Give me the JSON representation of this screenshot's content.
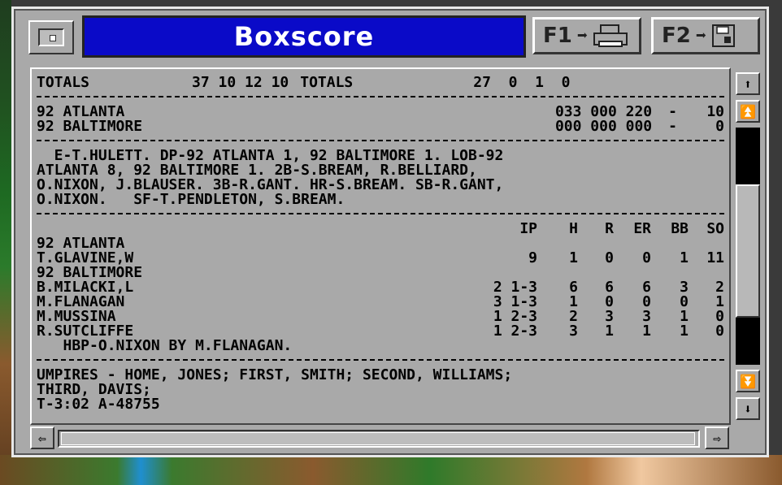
{
  "window": {
    "title": "Boxscore",
    "f1_label": "F1",
    "f2_label": "F2"
  },
  "totals": {
    "left": "TOTALS",
    "left_values": "37 10 12 10",
    "right": "TOTALS",
    "right_values": "27  0  1  0"
  },
  "linescore": [
    {
      "team": "92 ATLANTA",
      "innings": "033 000 220",
      "dash": "-",
      "runs": "10"
    },
    {
      "team": "92 BALTIMORE",
      "innings": "000 000 000",
      "dash": "-",
      "runs": "0"
    }
  ],
  "notes": [
    "  E-T.HULETT. DP-92 ATLANTA 1, 92 BALTIMORE 1. LOB-92",
    "ATLANTA 8, 92 BALTIMORE 1. 2B-S.BREAM, R.BELLIARD,",
    "O.NIXON, J.BLAUSER. 3B-R.GANT. HR-S.BREAM. SB-R.GANT,",
    "O.NIXON.   SF-T.PENDLETON, S.BREAM."
  ],
  "pitching": {
    "headers": [
      "IP",
      "H",
      "R",
      "ER",
      "BB",
      "SO"
    ],
    "teams": [
      {
        "name": "92 ATLANTA",
        "pitchers": [
          {
            "name": "T.GLAVINE,W",
            "ip": "9",
            "h": "1",
            "r": "0",
            "er": "0",
            "bb": "1",
            "so": "11"
          }
        ]
      },
      {
        "name": "92 BALTIMORE",
        "pitchers": [
          {
            "name": "B.MILACKI,L",
            "ip": "2 1-3",
            "h": "6",
            "r": "6",
            "er": "6",
            "bb": "3",
            "so": "2"
          },
          {
            "name": "M.FLANAGAN",
            "ip": "3 1-3",
            "h": "1",
            "r": "0",
            "er": "0",
            "bb": "0",
            "so": "1"
          },
          {
            "name": "M.MUSSINA",
            "ip": "1 2-3",
            "h": "2",
            "r": "3",
            "er": "3",
            "bb": "1",
            "so": "0"
          },
          {
            "name": "R.SUTCLIFFE",
            "ip": "1 2-3",
            "h": "3",
            "r": "1",
            "er": "1",
            "bb": "1",
            "so": "0"
          }
        ]
      }
    ],
    "note": "   HBP-O.NIXON BY M.FLANAGAN."
  },
  "umpires": [
    "UMPIRES - HOME, JONES; FIRST, SMITH; SECOND, WILLIAMS;",
    "THIRD, DAVIS;",
    "T-3:02 A-48755"
  ],
  "scrollbar": {
    "vertical_position": 0.55,
    "horizontal_position": 0.0
  }
}
